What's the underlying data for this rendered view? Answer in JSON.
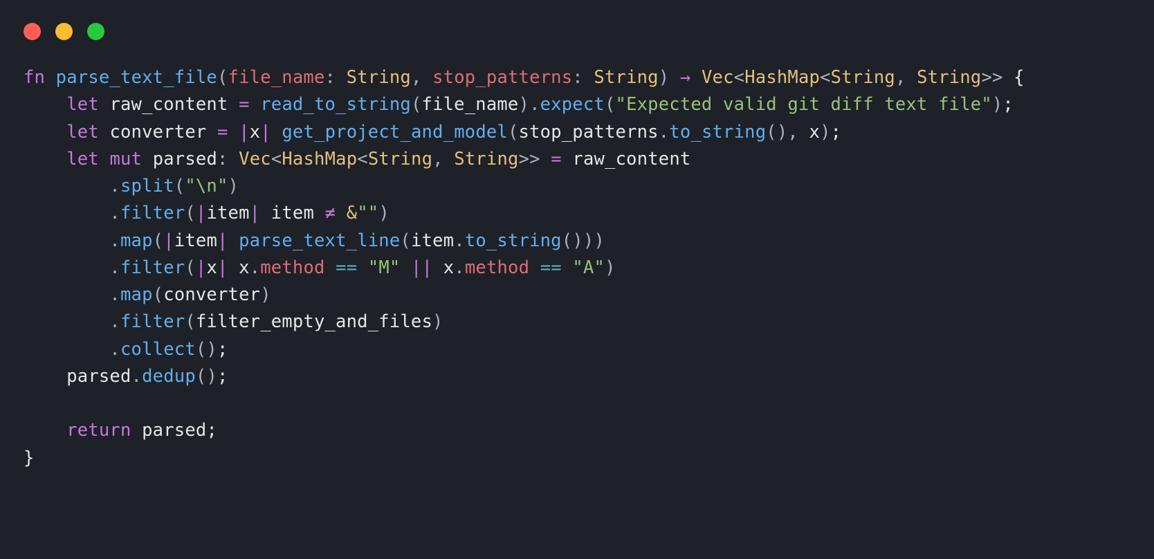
{
  "code": {
    "kw_fn": "fn",
    "fn_name": "parse_text_file",
    "param1": "file_name",
    "param2": "stop_patterns",
    "type_string": "String",
    "arrow": "→",
    "type_vec": "Vec",
    "type_hashmap": "HashMap",
    "lt": "<",
    "gt": ">",
    "gtgt": ">>",
    "kw_let": "let",
    "kw_mut": "mut",
    "var_raw": "raw_content",
    "fn_read": "read_to_string",
    "fn_expect": "expect",
    "str_expect": "\"Expected valid git diff text file\"",
    "var_converter": "converter",
    "var_x": "x",
    "fn_getproj": "get_project_and_model",
    "fn_tostring": "to_string",
    "var_parsed": "parsed",
    "fn_split": "split",
    "str_newline": "\"\\n\"",
    "fn_filter": "filter",
    "var_item": "item",
    "op_ne": "≠",
    "amp": "&",
    "str_empty": "\"\"",
    "fn_map": "map",
    "fn_parseline": "parse_text_line",
    "prop_method": "method",
    "op_eq": "==",
    "str_M": "\"M\"",
    "op_or": "||",
    "str_A": "\"A\"",
    "fn_filterempty": "filter_empty_and_files",
    "fn_collect": "collect",
    "fn_dedup": "dedup",
    "kw_return": "return",
    "open_brace": "{",
    "close_brace": "}",
    "open_paren": "(",
    "close_paren": ")",
    "colon": ":",
    "comma": ",",
    "semi": ";",
    "eq": "=",
    "pipe": "|",
    "dot": "."
  }
}
